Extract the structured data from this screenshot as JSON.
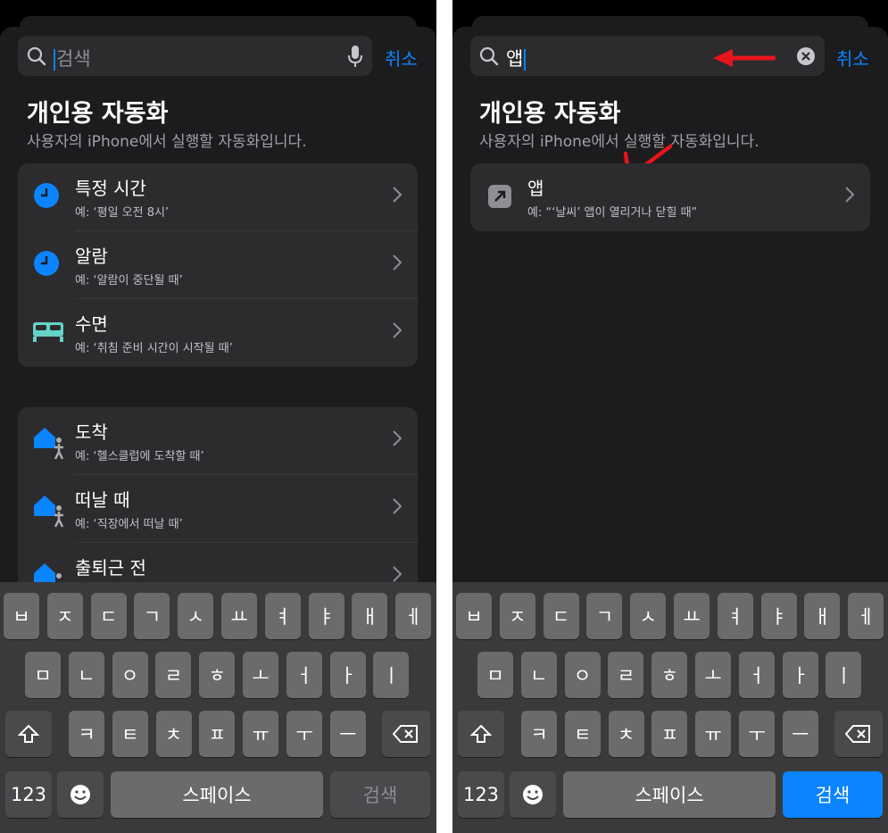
{
  "left": {
    "search": {
      "placeholder": "검색",
      "cancel": "취소"
    },
    "header": {
      "title": "개인용 자동화",
      "subtitle": "사용자의 iPhone에서 실행할 자동화입니다."
    },
    "group1": [
      {
        "icon": "clock-icon",
        "title": "특정 시간",
        "subtitle": "예: ‘평일 오전 8시’"
      },
      {
        "icon": "alarm-icon",
        "title": "알람",
        "subtitle": "예: ‘알람이 중단될 때’"
      },
      {
        "icon": "bed-icon",
        "title": "수면",
        "subtitle": "예: ‘취침 준비 시간이 시작될 때’"
      }
    ],
    "group2": [
      {
        "icon": "home-person-icon",
        "title": "도착",
        "subtitle": "예: ‘헬스클럽에 도착할 때’"
      },
      {
        "icon": "home-person-icon",
        "title": "떠날 때",
        "subtitle": "예: ‘직장에서 떠날 때’"
      },
      {
        "icon": "home-person-icon",
        "title": "출퇴근 전",
        "subtitle": ""
      }
    ],
    "keyboard": {
      "action": "검색",
      "action_enabled": false
    }
  },
  "right": {
    "search": {
      "value": "앱",
      "cancel": "취소"
    },
    "header": {
      "title": "개인용 자동화",
      "subtitle": "사용자의 iPhone에서 실행할 자동화입니다."
    },
    "results": [
      {
        "icon": "app-arrow-icon",
        "title": "앱",
        "subtitle": "예: “‘날씨’ 앱이 열리거나 닫힐 때”"
      }
    ],
    "keyboard": {
      "action": "검색",
      "action_enabled": true
    }
  },
  "keyboard": {
    "row1": [
      "ㅂ",
      "ㅈ",
      "ㄷ",
      "ㄱ",
      "ㅅ",
      "ㅛ",
      "ㅕ",
      "ㅑ",
      "ㅐ",
      "ㅔ"
    ],
    "row2": [
      "ㅁ",
      "ㄴ",
      "ㅇ",
      "ㄹ",
      "ㅎ",
      "ㅗ",
      "ㅓ",
      "ㅏ",
      "ㅣ"
    ],
    "row3": [
      "ㅋ",
      "ㅌ",
      "ㅊ",
      "ㅍ",
      "ㅠ",
      "ㅜ",
      "ㅡ"
    ],
    "numbers": "123",
    "space": "스페이스"
  },
  "colors": {
    "accent": "#0a84ff",
    "annotation": "#e8141c",
    "background": "#1c1c1e",
    "cell": "#2c2c2e"
  }
}
